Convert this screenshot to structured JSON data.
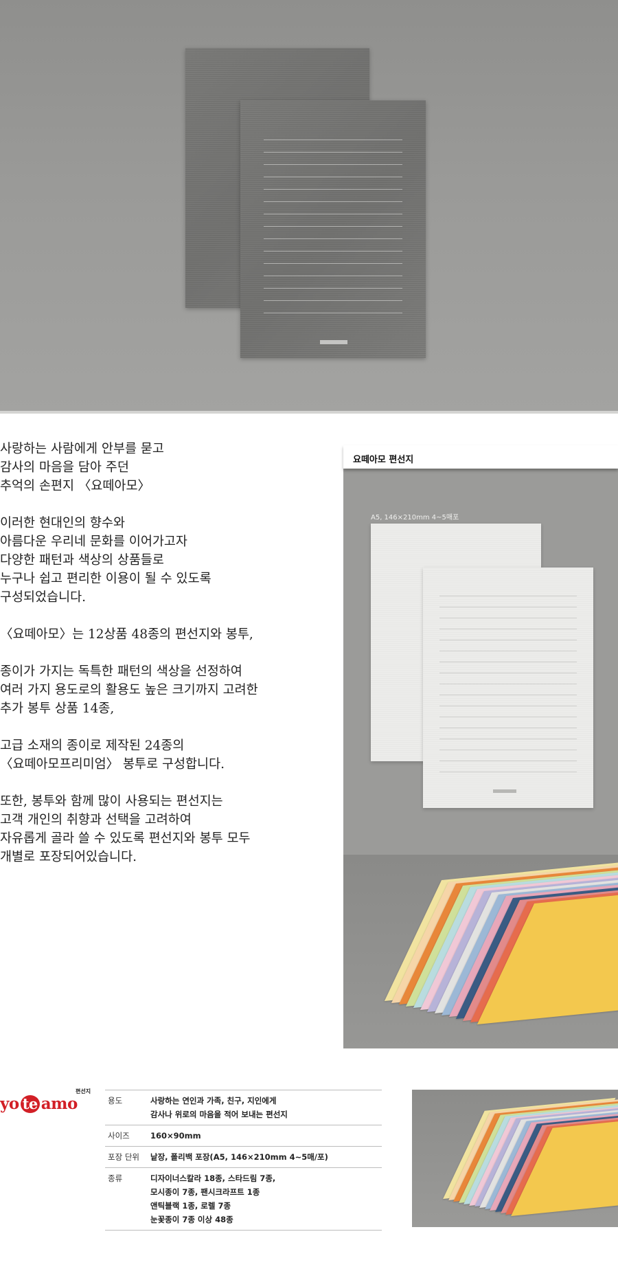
{
  "intro": {
    "paragraphs": [
      "사랑하는 사람에게 안부를 묻고\n감사의 마음을 담아 주던\n추억의 손편지 〈요떼아모〉",
      "이러한 현대인의 향수와\n아름다운 우리네 문화를 이어가고자\n다양한 패턴과 색상의 상품들로\n누구나 쉽고 편리한 이용이 될 수 있도록\n구성되었습니다.",
      "〈요떼아모〉는 12상품 48종의 편선지와 봉투,",
      "종이가 가지는 독특한 패턴의 색상을 선정하여\n여러 가지 용도로의 활용도 높은 크기까지 고려한\n추가 봉투 상품 14종,",
      "고급 소재의 종이로 제작된 24종의\n〈요떼아모프리미엄〉 봉투로 구성합니다.",
      "또한, 봉투와 함께 많이 사용되는 편선지는\n고객 개인의 취향과 선택을 고려하여\n자유롭게 골라 쓸 수 있도록 편선지와 봉투 모두\n개별로 포장되어있습니다."
    ]
  },
  "panel": {
    "title": "요떼아모 편선지",
    "spec": "A5, 146×210mm 4~5매포"
  },
  "brand": {
    "word_start": "yo",
    "word_mid": "te",
    "word_end": "amo",
    "sub": "편선지"
  },
  "specs": [
    {
      "label": "용도",
      "value": "사랑하는 연인과 가족, 친구, 지인에게\n감사나 위로의 마음을 적어 보내는 편선지"
    },
    {
      "label": "사이즈",
      "value": "160×90mm"
    },
    {
      "label": "포장 단위",
      "value": "낱장, 폴리백 포장(A5, 146×210mm 4~5매/포)"
    },
    {
      "label": "종류",
      "value": "디자이너스칼라 18종, 스타드림 7종,\n모시종이 7종, 팬시크라프트 1종\n앤틱블랙 1종, 로렐 7종\n눈꽃종이 7종 이상 48종"
    }
  ],
  "colors": {
    "brand_red": "#d21f26",
    "fan": [
      "#f1e3a0",
      "#f6d5a8",
      "#e8873a",
      "#cfe09a",
      "#b9dcdf",
      "#f0c8d6",
      "#b7b3d8",
      "#e2e2e0",
      "#9cb8d6",
      "#e7a7b9",
      "#3a5b83",
      "#e28a8a",
      "#e66c4d",
      "#f3c84e"
    ]
  }
}
